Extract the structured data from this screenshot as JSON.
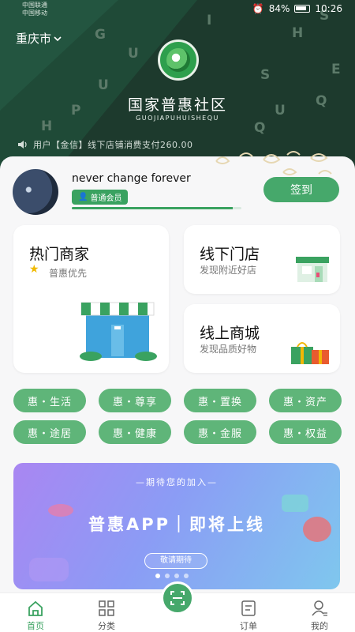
{
  "status_bar": {
    "carrier1": "中国联通",
    "carrier2": "中国移动",
    "battery": "84%",
    "time": "10:26"
  },
  "header": {
    "city": "重庆市",
    "brand_cn": "国家普惠社区",
    "brand_en": "GUOJIAPUHUISHEQU",
    "ticker": "用户【金信】线下店铺消费支付260.00",
    "bg_color": "#1d3a2d"
  },
  "user": {
    "name": "never change forever",
    "level": "普通会员",
    "progress": 0.95,
    "checkin_label": "签到"
  },
  "cards": {
    "hot": {
      "title": "热门商家",
      "subtitle": "普惠优先"
    },
    "offline": {
      "title": "线下门店",
      "subtitle": "发现附近好店"
    },
    "online": {
      "title": "线上商城",
      "subtitle": "发现品质好物"
    }
  },
  "tags": [
    "惠・生活",
    "惠・尊享",
    "惠・置换",
    "惠・资产",
    "惠・途居",
    "惠・健康",
    "惠・金服",
    "惠・权益"
  ],
  "banner": {
    "top_text": "—期待您的加入—",
    "main_text": "普惠APP｜即将上线",
    "button": "敬请期待",
    "dots": 4,
    "active_dot": 0
  },
  "tabbar": {
    "home": "首页",
    "category": "分类",
    "orders": "订单",
    "mine": "我的"
  },
  "colors": {
    "accent": "#3aa260",
    "tag": "#5fb579"
  }
}
